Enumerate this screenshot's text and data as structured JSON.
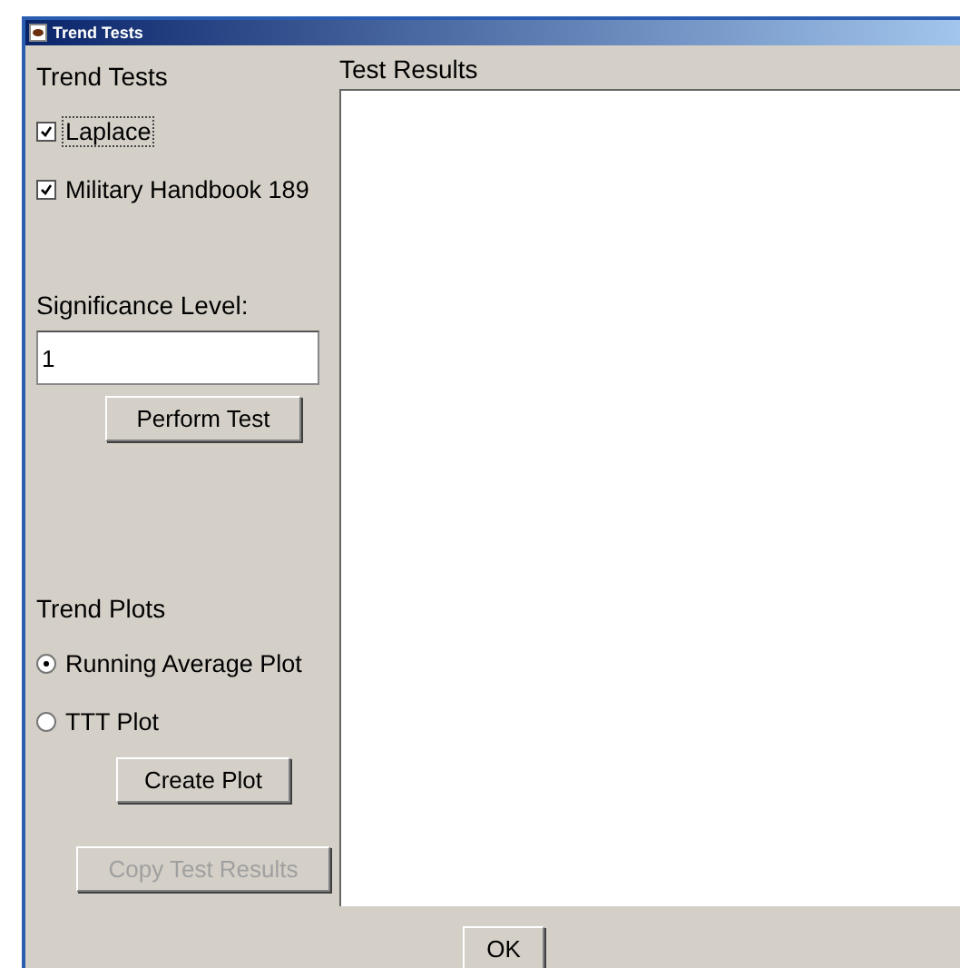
{
  "window": {
    "title": "Trend Tests"
  },
  "trend_tests": {
    "heading": "Trend Tests",
    "options": [
      {
        "label": "Laplace",
        "checked": true,
        "focused": true
      },
      {
        "label": "Military Handbook 189",
        "checked": true,
        "focused": false
      }
    ]
  },
  "significance": {
    "label": "Significance Level:",
    "value": "1"
  },
  "perform_button": {
    "label": "Perform Test",
    "disabled": false
  },
  "trend_plots": {
    "heading": "Trend Plots",
    "options": [
      {
        "label": "Running Average Plot",
        "selected": true
      },
      {
        "label": "TTT Plot",
        "selected": false
      }
    ]
  },
  "create_button": {
    "label": "Create Plot",
    "disabled": false
  },
  "copy_button": {
    "label": "Copy Test Results",
    "disabled": true
  },
  "results": {
    "label": "Test Results"
  },
  "ok_button": {
    "label": "OK",
    "disabled": false
  }
}
